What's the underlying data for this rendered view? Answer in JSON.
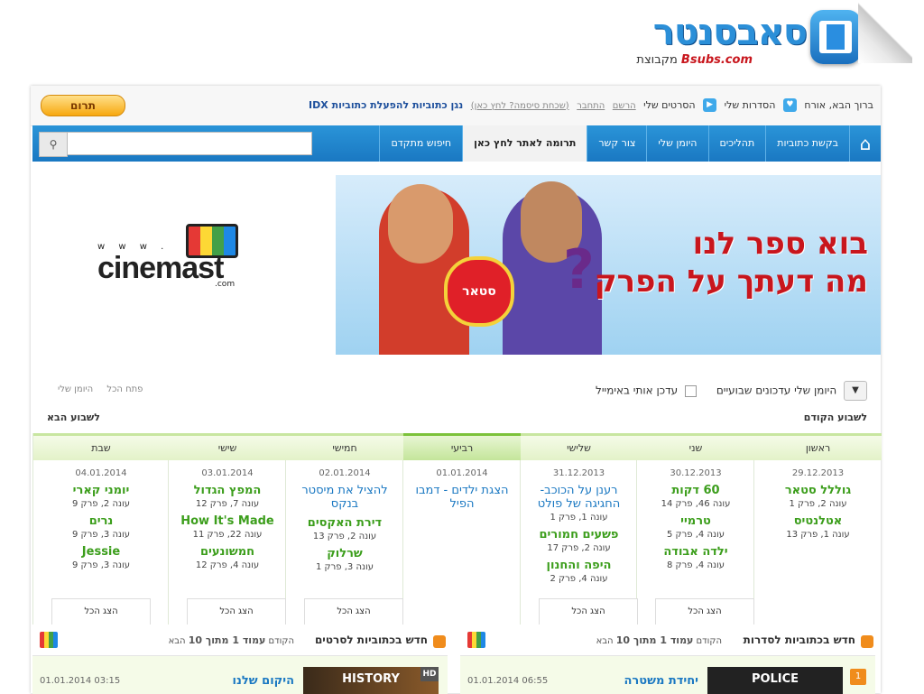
{
  "logo": {
    "title": "סאבסנטר",
    "group": "מקבוצת",
    "brand": "Bsubs.com"
  },
  "userbar": {
    "greeting": "ברוך הבא, אורח",
    "my_series": "הסדרות שלי",
    "my_movies": "הסרטים שלי",
    "register": "הרשם",
    "login": "התחבר",
    "forgot": "(שכחת סיסמה? לחץ כאן)",
    "idx": "נגן כתוביות להפעלת כתוביות IDX",
    "donate": "תרום"
  },
  "nav": {
    "items": [
      "בקשת כתוביות",
      "תהליכים",
      "היומן שלי",
      "צור קשר",
      "תרומה לאתר לחץ כאן",
      "חיפוש מתקדם"
    ],
    "search_placeholder": ""
  },
  "banners": {
    "cinemast_dots": "w w w .",
    "cinemast_word": "cinemast",
    "cinemast_com": ".com",
    "promo_line1": "בוא ספר לנו",
    "promo_line2": "מה דעתך על הפרק",
    "promo_badge": "סטאר"
  },
  "diary": {
    "title": "היומן שלי עדכונים שבועיים",
    "email": "עדכן אותי באימייל",
    "open_all": "פתח הכל",
    "my_diary": "היומן שלי",
    "prev_week": "לשבוע הקודם",
    "next_week": "לשבוע הבא",
    "show_all": "הצג הכל",
    "days": [
      {
        "name": "ראשון",
        "date": "29.12.2013",
        "eps": [
          {
            "title": "גוללל סטאר",
            "info": "עונה 2, פרק 1",
            "blue": false
          },
          {
            "title": "אטלנטיס",
            "info": "עונה 1, פרק 13",
            "blue": false
          }
        ]
      },
      {
        "name": "שני",
        "date": "30.12.2013",
        "eps": [
          {
            "title": "60 דקות",
            "info": "עונה 46, פרק 14",
            "blue": false
          },
          {
            "title": "טרמיי",
            "info": "עונה 4, פרק 5",
            "blue": false
          },
          {
            "title": "ילדה אבודה",
            "info": "עונה 4, פרק 8",
            "blue": false
          }
        ]
      },
      {
        "name": "שלישי",
        "date": "31.12.2013",
        "eps": [
          {
            "title": "רענן על הכוכב- החגיגה של פולט",
            "info": "עונה 1, פרק 1",
            "blue": true
          },
          {
            "title": "פשעים חמורים",
            "info": "עונה 2, פרק 17",
            "blue": false
          },
          {
            "title": "היפה והחנון",
            "info": "עונה 4, פרק 2",
            "blue": false
          }
        ]
      },
      {
        "name": "רביעי",
        "date": "01.01.2014",
        "eps": [
          {
            "title": "הצגת ילדים - דמבו הפיל",
            "info": "",
            "blue": true
          }
        ]
      },
      {
        "name": "חמישי",
        "date": "02.01.2014",
        "eps": [
          {
            "title": "להציל את מיסטר בנקס",
            "info": "",
            "blue": true
          },
          {
            "title": "דירת האקסים",
            "info": "עונה 2, פרק 13",
            "blue": false
          },
          {
            "title": "שרלוק",
            "info": "עונה 3, פרק 1",
            "blue": false
          }
        ]
      },
      {
        "name": "שישי",
        "date": "03.01.2014",
        "eps": [
          {
            "title": "המפץ הגדול",
            "info": "עונה 7, פרק 12",
            "blue": false
          },
          {
            "title": "How It's Made",
            "info": "עונה 22, פרק 11",
            "blue": false
          },
          {
            "title": "חמשונעים",
            "info": "עונה 4, פרק 12",
            "blue": false
          }
        ]
      },
      {
        "name": "שבת",
        "date": "04.01.2014",
        "eps": [
          {
            "title": "יומני קארי",
            "info": "עונה 2, פרק 9",
            "blue": false
          },
          {
            "title": "נרים",
            "info": "עונה 3, פרק 9",
            "blue": false
          },
          {
            "title": "Jessie",
            "info": "עונה 3, פרק 9",
            "blue": false
          }
        ]
      }
    ]
  },
  "news_series": {
    "title": "חדש בכתוביות לסדרות",
    "pager_prev": "הקודם",
    "page_label": "עמוד 1 מתוך 10",
    "pager_next": "הבא",
    "item_num": "1",
    "item_name": "יחידת משטרה",
    "item_date": "01.01.2014 06:55",
    "thumb_text": "POLICE"
  },
  "news_movies": {
    "title": "חדש בכתוביות לסרטים",
    "pager_prev": "הקודם",
    "page_label": "עמוד 1 מתוך 10",
    "pager_next": "הבא",
    "item_name": "היקום שלנו",
    "item_date": "01.01.2014 03:15",
    "thumb_text": "HISTORY",
    "hd": "HD"
  }
}
